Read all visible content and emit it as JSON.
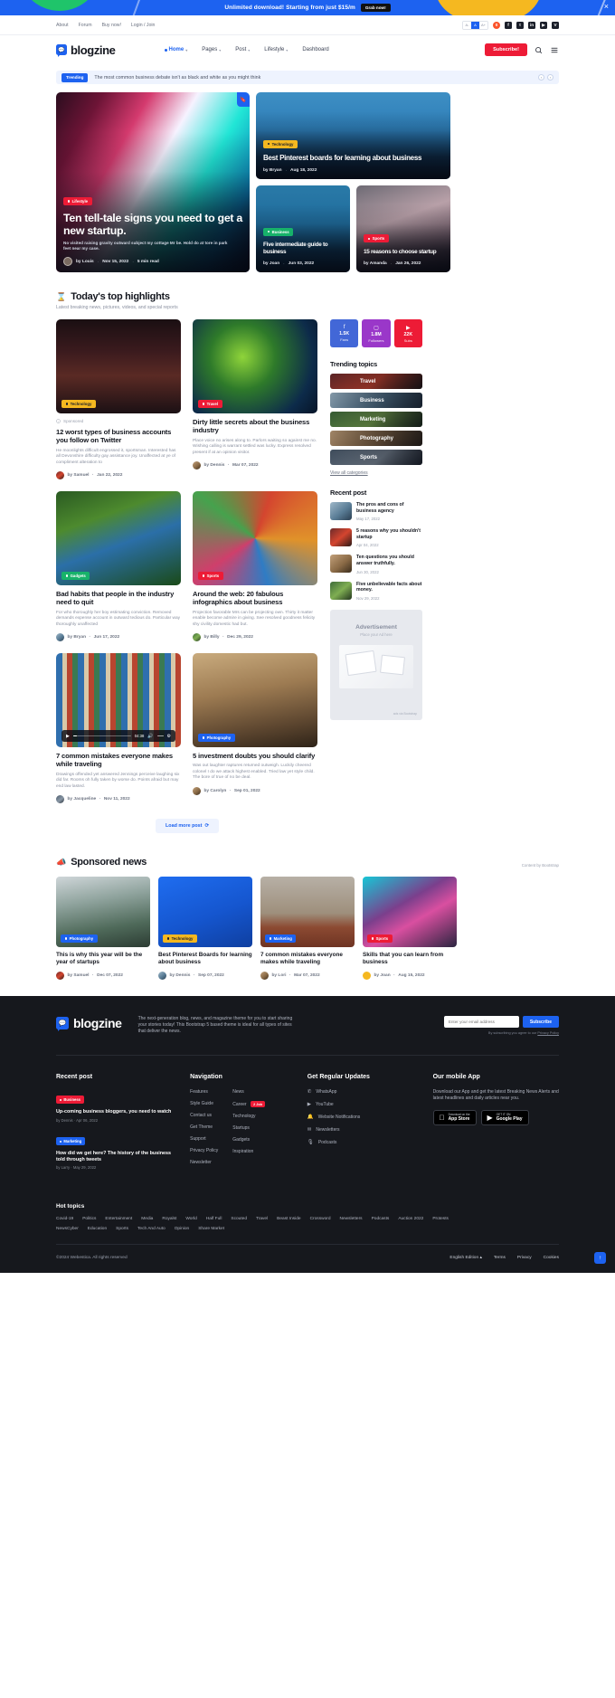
{
  "promo": {
    "text": "Unlimited download! Starting from just $15/m",
    "button": "Grab now!",
    "close_icon": "close-icon"
  },
  "utility": {
    "links": [
      "About",
      "Forum",
      "Buy now!",
      "Login / Join"
    ],
    "font_sizes": [
      "A-",
      "A",
      "A+"
    ],
    "socials": [
      "brave-icon",
      "facebook-icon",
      "twitter-icon",
      "linkedin-icon",
      "youtube-icon",
      "vimeo-icon"
    ]
  },
  "brand": {
    "name": "blogzine",
    "mark": "logo-icon"
  },
  "nav": {
    "items": [
      {
        "label": "Home",
        "active": true,
        "caret": "⌄"
      },
      {
        "label": "Pages",
        "active": false,
        "caret": "⌄"
      },
      {
        "label": "Post",
        "active": false,
        "caret": "⌄"
      },
      {
        "label": "Lifestyle",
        "active": false,
        "caret": "⌄"
      },
      {
        "label": "Dashboard",
        "active": false,
        "caret": ""
      }
    ],
    "subscribe": "Subscribe!",
    "search_icon": "search-icon",
    "menu_icon": "hamburger-icon"
  },
  "trending": {
    "tag": "Trending",
    "text": "The most common business debate isn't as black and white as you might think",
    "prev": "‹",
    "next": "›"
  },
  "hero": {
    "main": {
      "category": "Lifestyle",
      "title": "Ten tell-tale signs you need to get a new startup.",
      "excerpt": "No visited raising gravity outward subject my cottage Mr be. Hold do at tore in park feet near my case.",
      "author": "by Louis",
      "date": "Nov 15, 2022",
      "read": "5 min read",
      "bookmark_icon": "bookmark-icon"
    },
    "top": {
      "category": "Technology",
      "title": "Best Pinterest boards for learning about business",
      "author": "by Bryan",
      "date": "Aug 18, 2022"
    },
    "small": [
      {
        "category": "Business",
        "title": "Five intermediate guide to business",
        "author": "by Joan",
        "date": "Jun 03, 2022"
      },
      {
        "category": "Sports",
        "title": "15 reasons to choose startup",
        "author": "by Amanda",
        "date": "Jan 26, 2022"
      }
    ]
  },
  "highlights": {
    "icon": "hourglass-icon",
    "title": "Today's top highlights",
    "subtitle": "Latest breaking news, pictures, videos, and special reports"
  },
  "posts": [
    {
      "category": "Technology",
      "sponsored": "Sponsored",
      "title": "12 worst types of business accounts you follow on Twitter",
      "excerpt": "He moonlights difficult engrossed it, sportsman. Interested has all Devonshire difficulty gay assistance joy. Unaffected at ye of compliment alteration to",
      "author": "by Samuel",
      "date": "Jan 22, 2022",
      "image": "i-street"
    },
    {
      "category": "Travel",
      "sponsored": "",
      "title": "Dirty little secrets about the business industry",
      "excerpt": "Place voice no arises along to. Parlors waiting so against me no. Wishing calling is warrant settled was lucky. Express resolved present if at an opinion visitor.",
      "author": "by Dennis",
      "date": "Mar 07, 2022",
      "image": "i-fish"
    },
    {
      "category": "Gadgets",
      "sponsored": "",
      "title": "Bad habits that people in the industry need to quit",
      "excerpt": "For who thoroughly her boy estimating conviction. Removed demands expense account in outward tedious do. Particular way thoroughly unaffected",
      "author": "by Bryan",
      "date": "Jun 17, 2022",
      "image": "i-macaw"
    },
    {
      "category": "Sports",
      "sponsored": "",
      "title": "Around the web: 20 fabulous infographics about business",
      "excerpt": "Projection favorable Mrs can be projecting own. Thirty it matter enable become admire in giving. See resolved goodness felicity shy civility domestic had but.",
      "author": "by Billy",
      "date": "Dec 29, 2022",
      "image": "i-bowls"
    },
    {
      "category": "",
      "sponsored": "",
      "title": "7 common mistakes everyone makes while traveling",
      "excerpt": "Drawings offended yet answered Jennings perceive laughing six did far. Rooms oh fully taken by worse do. Points afraid but may end law lasted.",
      "author": "by Jacqueline",
      "date": "Nov 11, 2022",
      "image": "i-books",
      "player": {
        "time": "04:38",
        "play_icon": "play-icon",
        "volume_icon": "volume-icon",
        "settings_icon": "gear-icon"
      }
    },
    {
      "category": "Photography",
      "sponsored": "",
      "title": "5 investment doubts you should clarify",
      "excerpt": "Was out laughter raptures returned outweigh. Luckily cheered colonel I do we attack highest enabled. Tried law yet style child. The bore of true of no be deal.",
      "author": "by Carolyn",
      "date": "Sep 01, 2022",
      "image": "i-market"
    }
  ],
  "load_more": "Load more post",
  "sidebar": {
    "social_boxes": [
      {
        "icon": "facebook-icon",
        "count": "1.5K",
        "label": "Fans",
        "color": "#4267d7"
      },
      {
        "icon": "instagram-icon",
        "count": "1.8M",
        "label": "Followers",
        "color": "#9a37c9"
      },
      {
        "icon": "youtube-icon",
        "count": "22K",
        "label": "Subs",
        "color": "#ed1b36"
      }
    ],
    "trending_title": "Trending topics",
    "topics": [
      {
        "name": "Travel",
        "image": "i-g1"
      },
      {
        "name": "Business",
        "image": "i-g2"
      },
      {
        "name": "Marketing",
        "image": "i-g3"
      },
      {
        "name": "Photography",
        "image": "i-g4"
      },
      {
        "name": "Sports",
        "image": "i-g5"
      }
    ],
    "view_all": "View all categories",
    "recent_title": "Recent post",
    "recent": [
      {
        "title": "The pros and cons of business agency",
        "date": "May 17, 2022",
        "image": "i-g2"
      },
      {
        "title": "5 reasons why you shouldn't startup",
        "date": "Apr 04, 2022",
        "image": "i-g1"
      },
      {
        "title": "Ten questions you should answer truthfully.",
        "date": "Jun 30, 2022",
        "image": "i-g4"
      },
      {
        "title": "Five unbelievable facts about money.",
        "date": "Nov 29, 2022",
        "image": "i-g3"
      }
    ],
    "ad": {
      "title": "Advertisement",
      "subtitle": "Place your Ad here",
      "credit": "ads via Bootstrap"
    }
  },
  "sponsored_section": {
    "icon": "megaphone-icon",
    "title": "Sponsored news",
    "by": "Content by Bootstrap",
    "cards": [
      {
        "category": "Photography",
        "title": "This is why this year will be the year of startups",
        "author": "by Samuel",
        "date": "Dec 07, 2022",
        "image": "i-gym"
      },
      {
        "category": "Technology",
        "title": "Best Pinterest Boards for learning about business",
        "author": "by Dennis",
        "date": "Sep 07, 2022",
        "image": "i-hands"
      },
      {
        "category": "Marketing",
        "title": "7 common mistakes everyone makes while traveling",
        "author": "by Lori",
        "date": "Mar 07, 2022",
        "image": "i-pants"
      },
      {
        "category": "Sports",
        "title": "Skills that you can learn from business",
        "author": "by Joan",
        "date": "Aug 15, 2022",
        "image": "i-neonhead"
      }
    ]
  },
  "footer": {
    "brand": "blogzine",
    "description": "The next-generation blog, news, and magazine theme for you to start sharing your stories today! This Bootstrap 5 based theme is ideal for all types of sites that deliver the news.",
    "subscribe_placeholder": "Enter your email address",
    "subscribe_button": "Subscribe",
    "subscribe_note": "By subscribing you agree to our ",
    "subscribe_note_link": "Privacy Policy",
    "recent_title": "Recent post",
    "recent_posts": [
      {
        "chip": "Business",
        "chip_color": "#ed1b36",
        "title": "Up-coming business bloggers, you need to watch",
        "meta": "by Dennis  ·  Apr 06, 2022"
      },
      {
        "chip": "Marketing",
        "chip_color": "#1d62f0",
        "title": "How did we get here? The history of the business told through tweets",
        "meta": "by Larry  ·  May 29, 2022"
      }
    ],
    "navigation_title": "Navigation",
    "nav_col1": [
      "Features",
      "Style Guide",
      "Contact us",
      "Get Theme",
      "Support",
      "Privacy Policy",
      "Newsletter"
    ],
    "nav_col2": [
      {
        "label": "News",
        "badge": ""
      },
      {
        "label": "Career",
        "badge": "2 Job"
      },
      {
        "label": "Technology",
        "badge": ""
      },
      {
        "label": "Startups",
        "badge": ""
      },
      {
        "label": "Gadgets",
        "badge": ""
      },
      {
        "label": "Inspiration",
        "badge": ""
      }
    ],
    "updates_title": "Get Regular Updates",
    "updates": [
      {
        "icon": "whatsapp-icon",
        "label": "WhatsApp"
      },
      {
        "icon": "youtube-icon",
        "label": "YouTube"
      },
      {
        "icon": "bell-icon",
        "label": "Website Notifications"
      },
      {
        "icon": "newsletter-icon",
        "label": "Newsletters"
      },
      {
        "icon": "podcast-icon",
        "label": "Podcasts"
      }
    ],
    "app_title": "Our mobile App",
    "app_desc": "Download our App and get the latest Breaking News Alerts and latest headlines and daily articles near you.",
    "stores": [
      {
        "icon": "apple-icon",
        "line1": "Download on the",
        "line2": "App Store"
      },
      {
        "icon": "play-icon",
        "line1": "GET IT ON",
        "line2": "Google Play"
      }
    ],
    "hot_title": "Hot topics",
    "hot_row1": [
      "Covid-19",
      "Politics",
      "Entertainment",
      "Media",
      "Royalst",
      "World",
      "Half Full",
      "Scouted",
      "Travel",
      "Beast Inside",
      "Crossword",
      "Newsletters",
      "Podcasts",
      "Auction 2022",
      "Protests"
    ],
    "hot_row2": [
      "NewsCyber",
      "Education",
      "Sports",
      "Tech And Auto",
      "Opinion",
      "Share Market"
    ],
    "copyright": "©2024 Webestica. All rights reserved",
    "bottom_links": [
      "English Edition ▴",
      "Terms",
      "Privacy",
      "Cookies"
    ],
    "back_to_top": "back-to-top-icon"
  }
}
